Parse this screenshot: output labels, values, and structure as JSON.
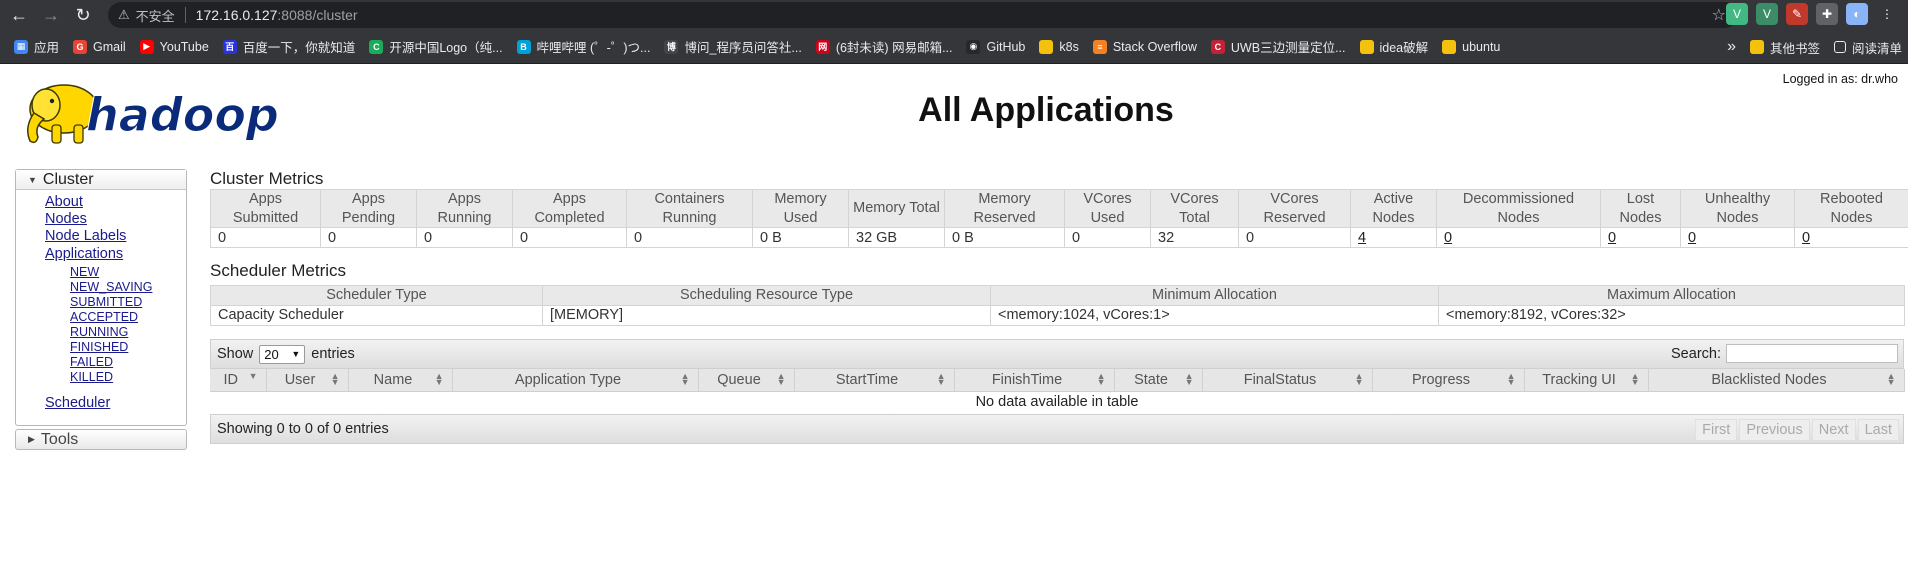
{
  "browser": {
    "back_glyph": "←",
    "forward_glyph": "→",
    "reload_glyph": "↻",
    "warning_glyph": "⚠",
    "insecure_label": "不安全",
    "url_host": "172.16.0.127",
    "url_rest": ":8088/cluster",
    "star_glyph": "☆",
    "extensions": [
      {
        "name": "vue-devtools-icon",
        "glyph": "V",
        "color": "#42b883"
      },
      {
        "name": "vue-devtools-2-icon",
        "glyph": "V",
        "color": "#3c8c68"
      },
      {
        "name": "image-tool-icon",
        "glyph": "✎",
        "color": "#c0392b"
      },
      {
        "name": "puzzle-icon",
        "glyph": "✚",
        "color": "#5f6368"
      },
      {
        "name": "profile-avatar",
        "glyph": "◐",
        "color": "#8ab4f8"
      },
      {
        "name": "menu-icon",
        "glyph": "⋮",
        "color": "#35363a"
      }
    ]
  },
  "bookmarks": [
    {
      "label": "应用",
      "icon": "apps-icon",
      "color": "#4285f4",
      "glyph": "▦"
    },
    {
      "label": "Gmail",
      "icon": "google-icon",
      "color": "#ea4335",
      "glyph": "G"
    },
    {
      "label": "YouTube",
      "icon": "youtube-icon",
      "color": "#ff0000",
      "glyph": "▶"
    },
    {
      "label": "百度一下，你就知道",
      "icon": "baidu-icon",
      "color": "#2932e1",
      "glyph": "百"
    },
    {
      "label": "开源中国Logo（纯...",
      "icon": "oschina-icon",
      "color": "#1aab5b",
      "glyph": "C"
    },
    {
      "label": "哔哩哔哩 (゜-゜)つ...",
      "icon": "bilibili-icon",
      "color": "#00a1d6",
      "glyph": "B"
    },
    {
      "label": "博问_程序员问答社...",
      "icon": "cnblogs-icon",
      "color": "#444444",
      "glyph": "博"
    },
    {
      "label": "(6封未读) 网易邮箱...",
      "icon": "netease-mail-icon",
      "color": "#d0021b",
      "glyph": "网"
    },
    {
      "label": "GitHub",
      "icon": "github-icon",
      "color": "#24292e",
      "glyph": "◉"
    },
    {
      "label": "k8s",
      "icon": "folder-icon",
      "color": "#f4c20d",
      "glyph": ""
    },
    {
      "label": "Stack Overflow",
      "icon": "stackoverflow-icon",
      "color": "#f48024",
      "glyph": "≡"
    },
    {
      "label": "UWB三边测量定位...",
      "icon": "csdn-icon",
      "color": "#c32136",
      "glyph": "C"
    },
    {
      "label": "idea破解",
      "icon": "folder-icon",
      "color": "#f4c20d",
      "glyph": ""
    },
    {
      "label": "ubuntu",
      "icon": "folder-icon",
      "color": "#f4c20d",
      "glyph": ""
    }
  ],
  "bookmarks_right": {
    "more_glyph": "»",
    "other_label": "其他书签",
    "reading_label": "阅读清单"
  },
  "header": {
    "logged_in": "Logged in as: dr.who",
    "title": "All Applications",
    "logo_text": "hadoop"
  },
  "sidebar": {
    "cluster_label": "Cluster",
    "cluster_links": [
      "About",
      "Nodes",
      "Node Labels",
      "Applications"
    ],
    "app_states": [
      "NEW",
      "NEW_SAVING",
      "SUBMITTED",
      "ACCEPTED",
      "RUNNING",
      "FINISHED",
      "FAILED",
      "KILLED"
    ],
    "scheduler_label": "Scheduler",
    "tools_label": "Tools"
  },
  "cluster_metrics": {
    "title": "Cluster Metrics",
    "headers": [
      "Apps Submitted",
      "Apps Pending",
      "Apps Running",
      "Apps Completed",
      "Containers Running",
      "Memory Used",
      "Memory Total",
      "Memory Reserved",
      "VCores Used",
      "VCores Total",
      "VCores Reserved",
      "Active Nodes",
      "Decommissioned Nodes",
      "Lost Nodes",
      "Unhealthy Nodes",
      "Rebooted Nodes"
    ],
    "values": [
      "0",
      "0",
      "0",
      "0",
      "0",
      "0 B",
      "32 GB",
      "0 B",
      "0",
      "32",
      "0",
      "4",
      "0",
      "0",
      "0",
      "0"
    ],
    "link_indices": [
      11,
      12,
      13,
      14,
      15
    ]
  },
  "scheduler_metrics": {
    "title": "Scheduler Metrics",
    "headers": [
      "Scheduler Type",
      "Scheduling Resource Type",
      "Minimum Allocation",
      "Maximum Allocation"
    ],
    "values": [
      "Capacity Scheduler",
      "[MEMORY]",
      "<memory:1024, vCores:1>",
      "<memory:8192, vCores:32>"
    ]
  },
  "apps_table": {
    "show_label": "Show",
    "page_size": "20",
    "entries_label": "entries",
    "search_label": "Search:",
    "columns": [
      "ID",
      "User",
      "Name",
      "Application Type",
      "Queue",
      "StartTime",
      "FinishTime",
      "State",
      "FinalStatus",
      "Progress",
      "Tracking UI",
      "Blacklisted Nodes"
    ],
    "empty_message": "No data available in table",
    "info": "Showing 0 to 0 of 0 entries",
    "paging": [
      "First",
      "Previous",
      "Next",
      "Last"
    ]
  }
}
